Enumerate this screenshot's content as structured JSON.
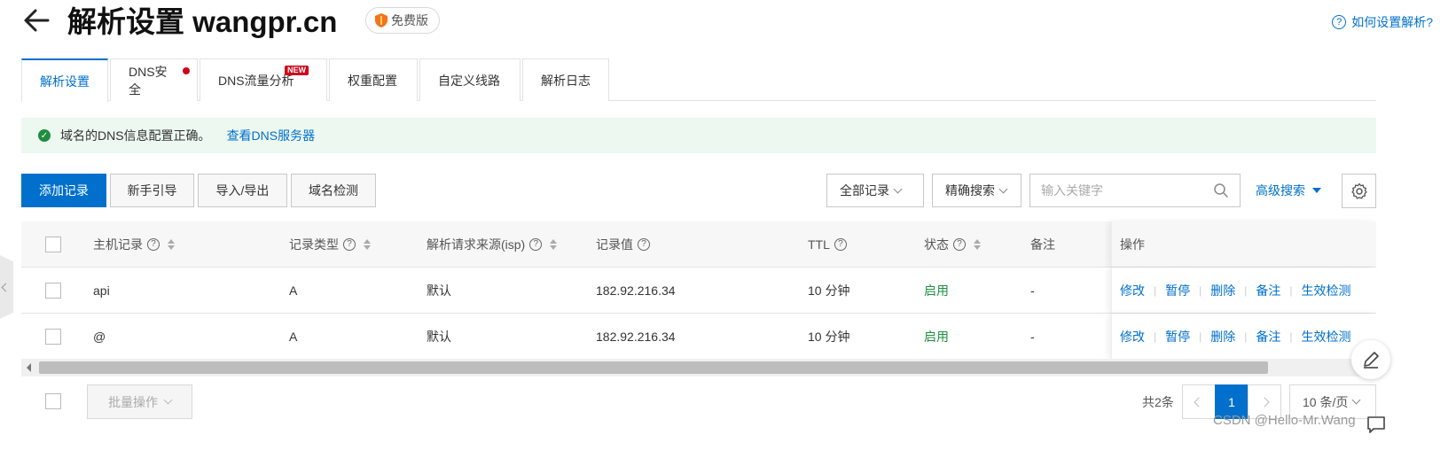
{
  "header": {
    "title": "解析设置 wangpr.cn",
    "edition_badge": "免费版",
    "help_link": "如何设置解析?"
  },
  "tabs": [
    {
      "label": "解析设置",
      "active": true
    },
    {
      "label": "DNS安全",
      "badge": "red-dot"
    },
    {
      "label": "DNS流量分析",
      "badge": "NEW"
    },
    {
      "label": "权重配置"
    },
    {
      "label": "自定义线路"
    },
    {
      "label": "解析日志"
    }
  ],
  "alert": {
    "message": "域名的DNS信息配置正确。",
    "link": "查看DNS服务器"
  },
  "toolbar": {
    "add_record": "添加记录",
    "guide": "新手引导",
    "import_export": "导入/导出",
    "domain_check": "域名检测",
    "record_filter": "全部记录",
    "search_mode": "精确搜索",
    "search_placeholder": "输入关键字",
    "advanced_search": "高级搜索"
  },
  "table": {
    "columns": {
      "host": "主机记录",
      "type": "记录类型",
      "isp": "解析请求来源(isp)",
      "value": "记录值",
      "ttl": "TTL",
      "status": "状态",
      "remark": "备注",
      "actions": "操作"
    },
    "rows": [
      {
        "host": "api",
        "type": "A",
        "isp": "默认",
        "value": "182.92.216.34",
        "ttl": "10 分钟",
        "status": "启用",
        "remark": "-"
      },
      {
        "host": "@",
        "type": "A",
        "isp": "默认",
        "value": "182.92.216.34",
        "ttl": "10 分钟",
        "status": "启用",
        "remark": "-"
      }
    ],
    "row_actions": [
      "修改",
      "暂停",
      "删除",
      "备注",
      "生效检测"
    ]
  },
  "footer": {
    "batch_ops": "批量操作",
    "total": "共2条",
    "current_page": "1",
    "page_size": "10 条/页"
  },
  "watermark": "CSDN @Hello-Mr.Wang",
  "colors": {
    "primary": "#0070cc",
    "success": "#1e8e3e",
    "alert_bg": "#ecf8f0",
    "badge_red": "#d0021b"
  },
  "icons": [
    "back-arrow-icon",
    "shield-icon",
    "help-circle-icon",
    "check-circle-icon",
    "search-icon",
    "gear-icon",
    "edit-pen-icon",
    "chat-icon"
  ]
}
